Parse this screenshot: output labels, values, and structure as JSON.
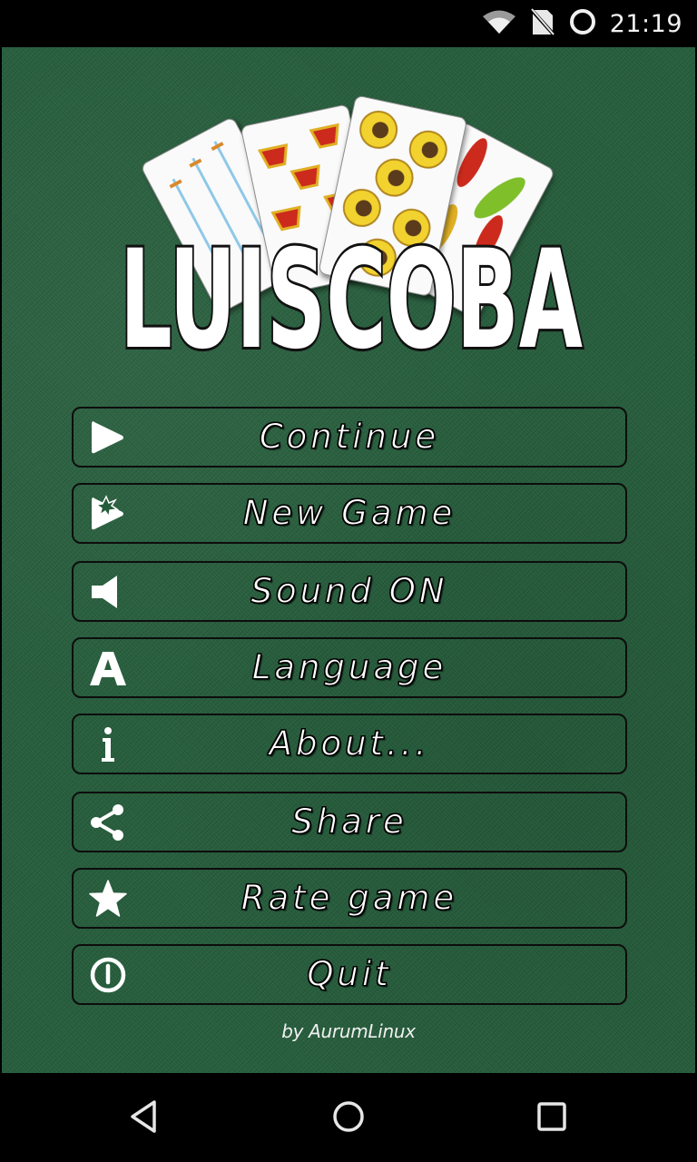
{
  "status_bar": {
    "time": "21:19",
    "icons": [
      "wifi-icon",
      "no-sim-icon",
      "sync-circle-icon"
    ]
  },
  "app": {
    "title": "LUISCOBA",
    "logo_cards": [
      "swords-card",
      "cups-card",
      "coins-card",
      "clubs-card"
    ]
  },
  "menu": {
    "items": [
      {
        "id": "continue",
        "label": "Continue",
        "icon": "play-icon"
      },
      {
        "id": "new-game",
        "label": "New Game",
        "icon": "play-sparkle-icon"
      },
      {
        "id": "sound",
        "label": "Sound ON",
        "icon": "speaker-icon"
      },
      {
        "id": "language",
        "label": "Language",
        "icon": "letter-a-icon"
      },
      {
        "id": "about",
        "label": "About...",
        "icon": "info-icon"
      },
      {
        "id": "share",
        "label": "Share",
        "icon": "share-icon"
      },
      {
        "id": "rate",
        "label": "Rate game",
        "icon": "star-icon"
      },
      {
        "id": "quit",
        "label": "Quit",
        "icon": "power-icon"
      }
    ]
  },
  "footer": {
    "credit": "by AurumLinux"
  },
  "navigation": {
    "buttons": [
      "back",
      "home",
      "recents"
    ]
  },
  "colors": {
    "felt": "#245c3a",
    "button_border": "#0d0d0d",
    "text": "#ffffff"
  }
}
